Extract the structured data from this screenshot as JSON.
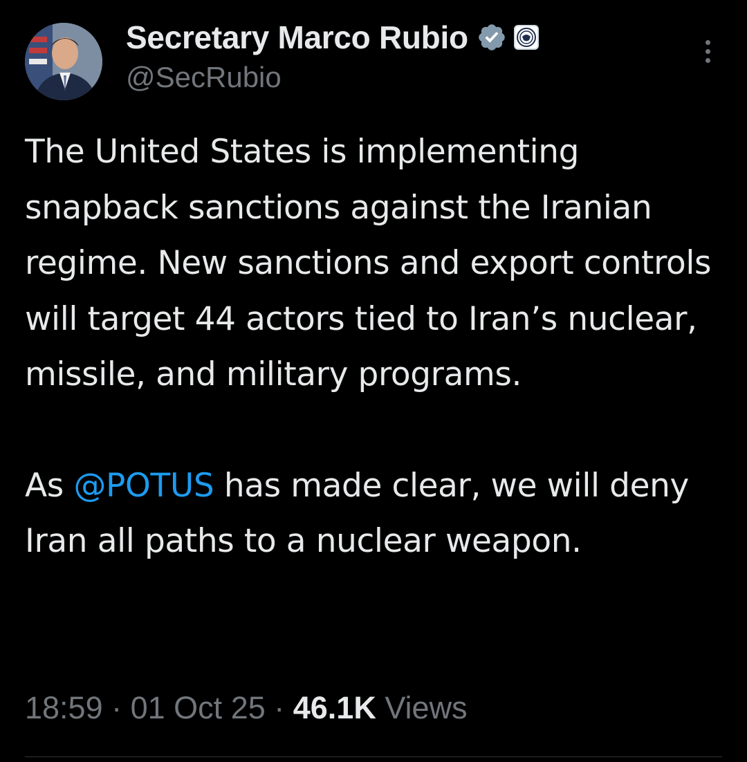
{
  "author": {
    "display_name": "Secretary Marco Rubio",
    "handle": "@SecRubio",
    "verified_icon": "verified-badge-icon",
    "affiliate_icon": "state-department-seal-icon"
  },
  "tweet": {
    "paragraph1": "The United States is implementing snapback sanctions against the Iranian regime. New sanctions and export controls will target 44 actors tied to Iran’s nuclear, missile, and military programs.",
    "paragraph2_prefix": "As ",
    "mention": "@POTUS",
    "paragraph2_suffix": " has made clear, we will deny Iran all paths to a nuclear weapon."
  },
  "meta": {
    "time": "18:59",
    "separator": " · ",
    "date": "01 Oct 25",
    "views_count": "46.1K",
    "views_label": " Views"
  },
  "colors": {
    "background": "#000000",
    "text": "#e7e9ea",
    "secondary": "#71767b",
    "accent": "#1d9bf0"
  }
}
